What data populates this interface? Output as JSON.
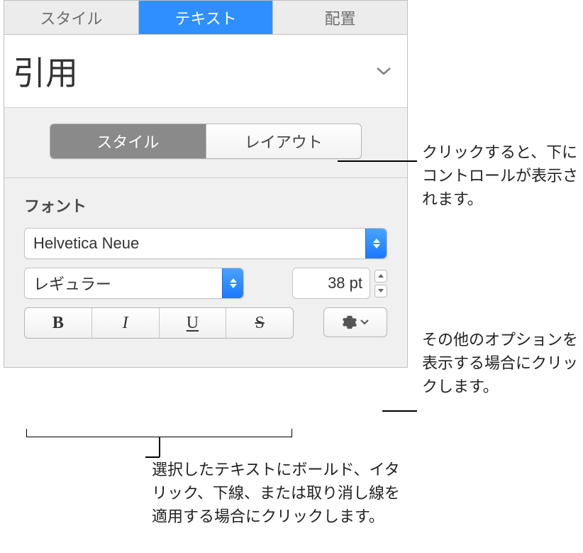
{
  "tabs": {
    "style": "スタイル",
    "text": "テキスト",
    "arrange": "配置"
  },
  "paragraph_style": {
    "name": "引用"
  },
  "segmented": {
    "style": "スタイル",
    "layout": "レイアウト"
  },
  "font_section": {
    "label": "フォント",
    "family": "Helvetica Neue",
    "typeface": "レギュラー",
    "size": "38 pt"
  },
  "format_buttons": {
    "bold": "B",
    "italic": "I",
    "underline": "U",
    "strike": "S"
  },
  "callouts": {
    "segmented": "クリックすると、下にコントロールが表示されます。",
    "gear": "その他のオプションを表示する場合にクリックします。",
    "bius": "選択したテキストにボールド、イタリック、下線、または取り消し線を適用する場合にクリックします。"
  }
}
